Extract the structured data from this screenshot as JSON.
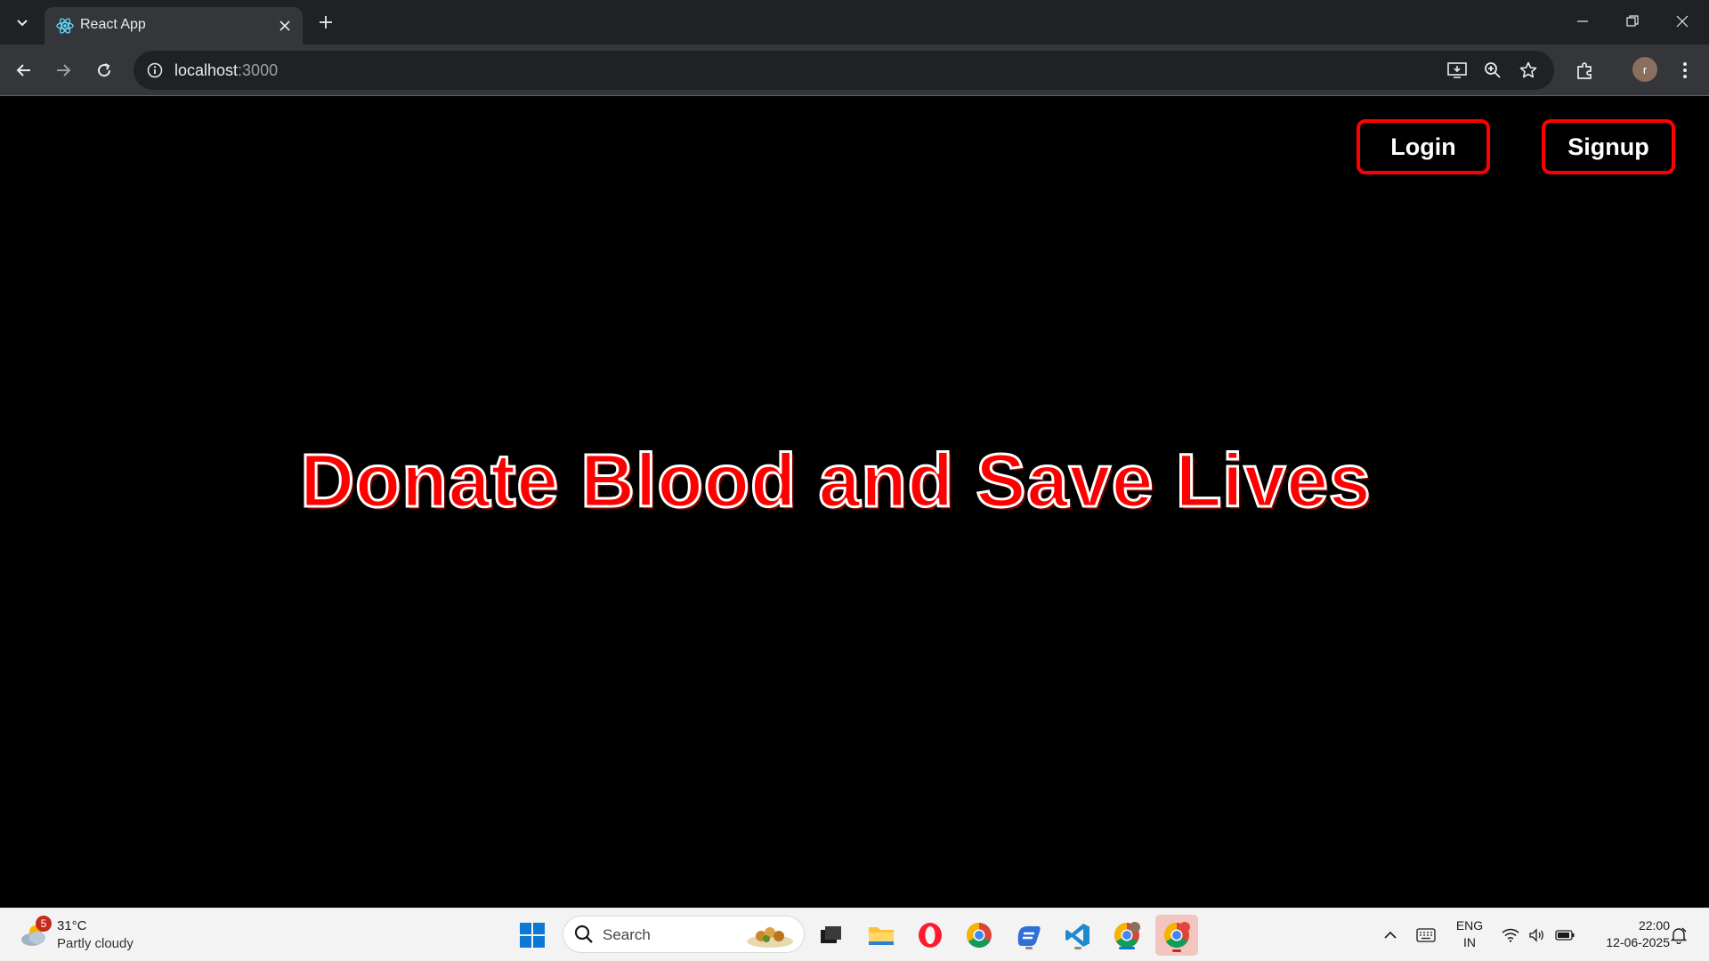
{
  "browser": {
    "tab_title": "React App",
    "url_host": "localhost",
    "url_port": ":3000",
    "profile_initial": "r"
  },
  "page": {
    "login_label": "Login",
    "signup_label": "Signup",
    "hero_text": "Donate Blood and Save Lives",
    "accent_color": "#ff0000",
    "background_color": "#000000"
  },
  "taskbar": {
    "weather_badge": "5",
    "weather_temp": "31°C",
    "weather_desc": "Partly cloudy",
    "search_label": "Search",
    "lang_line1": "ENG",
    "lang_line2": "IN",
    "time": "22:00",
    "date": "12-06-2025",
    "chrome_profile_badge": "R",
    "apps": [
      "start-icon",
      "search",
      "file-explorer-icon",
      "folder-icon",
      "opera-icon",
      "chrome-icon",
      "copilot-icon",
      "vscode-icon",
      "chrome-profile-r-icon",
      "chrome-profile-R-icon"
    ]
  }
}
